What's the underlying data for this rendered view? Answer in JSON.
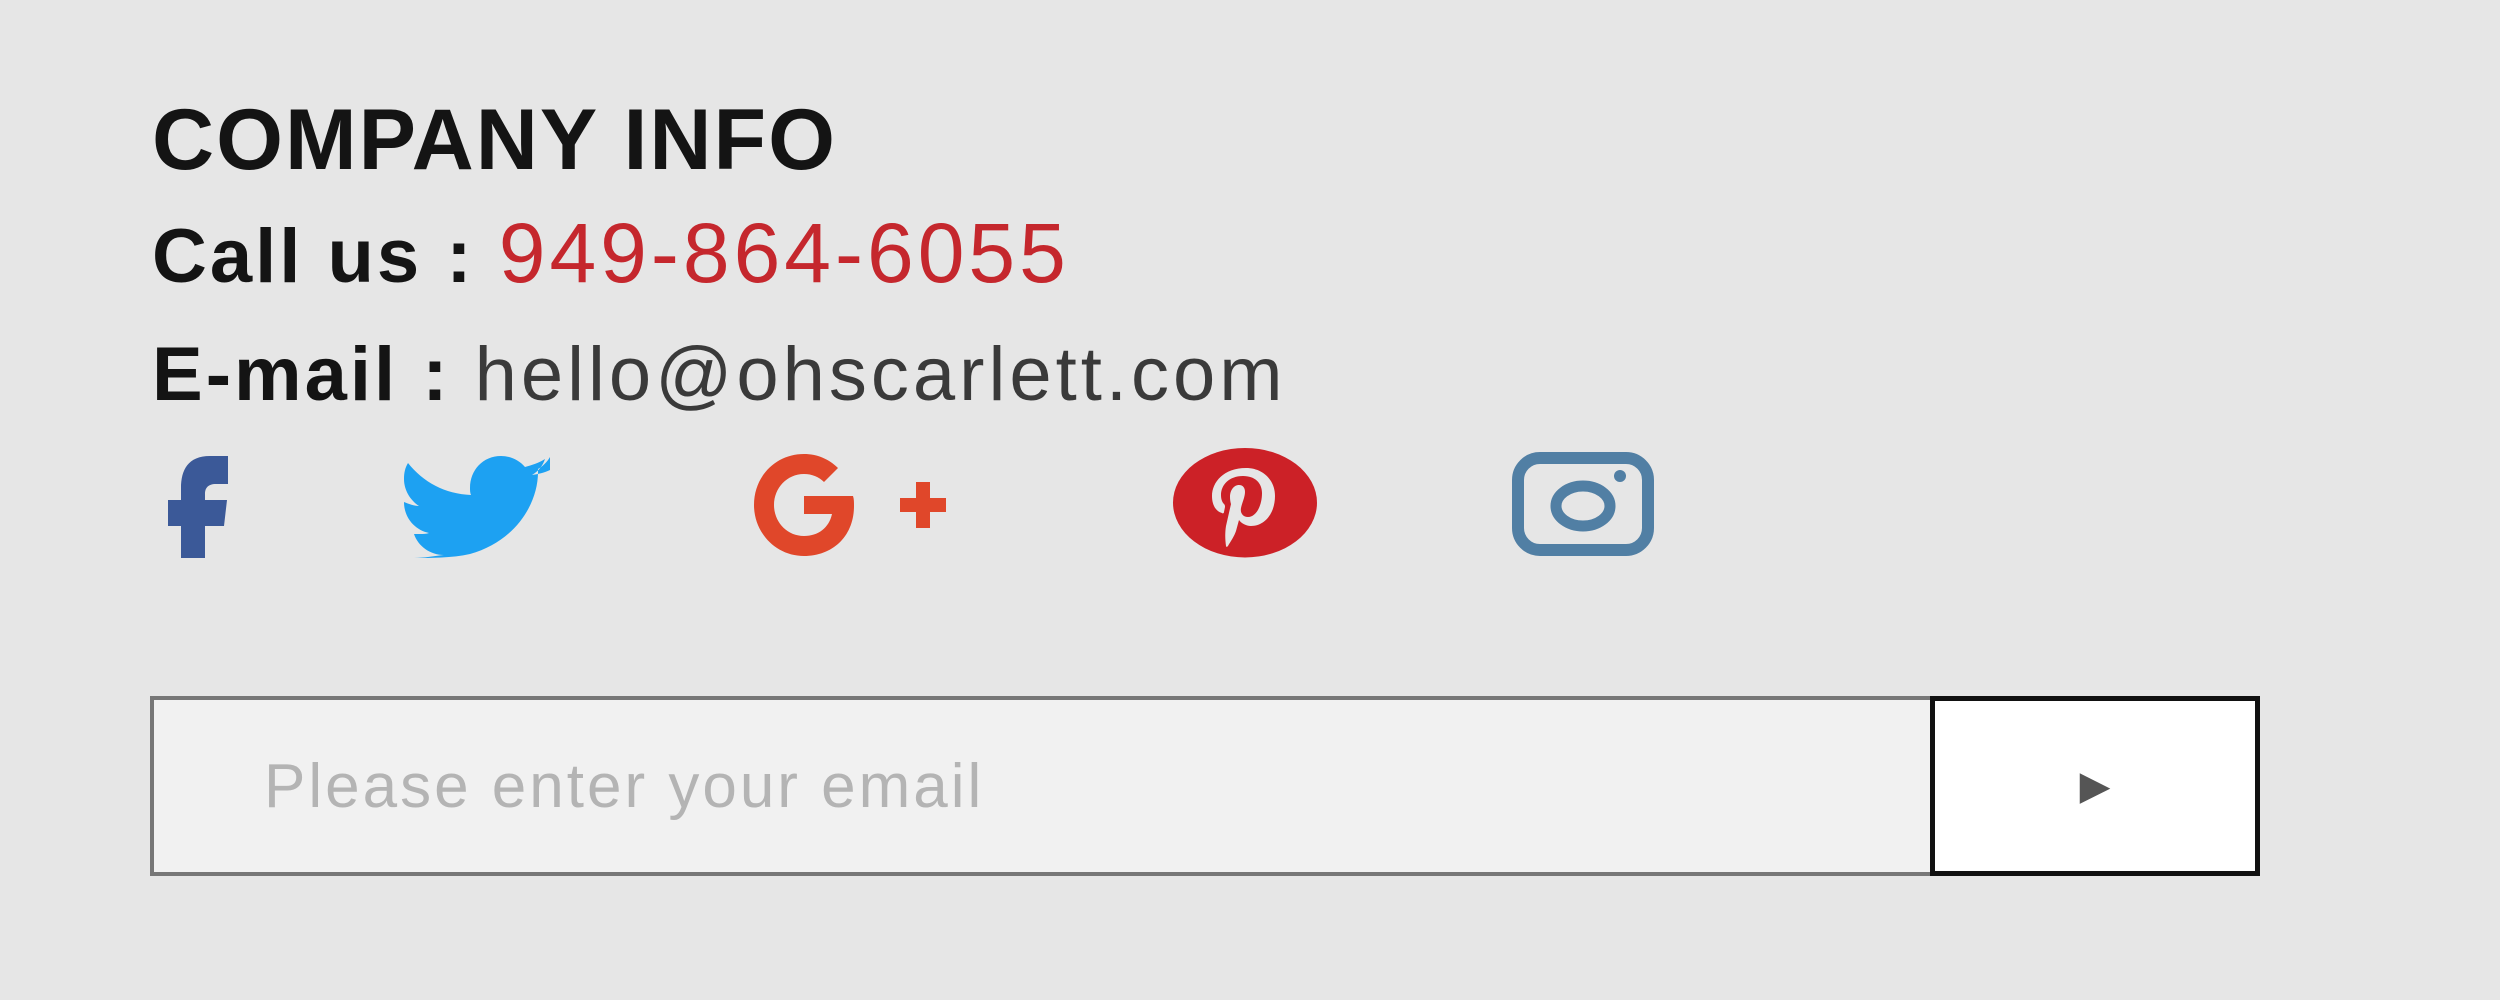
{
  "company_info": {
    "heading": "COMPANY INFO",
    "phone_label": "Call us :",
    "phone_value": "949-864-6055",
    "email_label": "E-mail :",
    "email_value": "hello@ohscarlett.com"
  },
  "social": [
    {
      "name": "facebook-icon",
      "color": "#3b5998"
    },
    {
      "name": "twitter-icon",
      "color": "#1da1f2"
    },
    {
      "name": "google-plus-icon",
      "color": "#e0472a"
    },
    {
      "name": "pinterest-icon",
      "color": "#cc2127"
    },
    {
      "name": "instagram-icon",
      "color": "#517fa4"
    }
  ],
  "newsletter": {
    "placeholder": "Please enter your email",
    "submit_icon": "play-arrow-icon",
    "submit_glyph": "▶"
  },
  "colors": {
    "background": "#e6e6e6",
    "phone_accent": "#c5272d",
    "input_background": "#f1f1f1",
    "button_background": "#ffffff"
  }
}
